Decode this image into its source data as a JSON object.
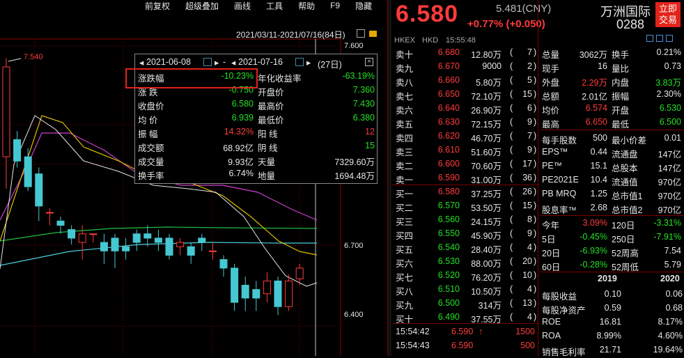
{
  "menu": [
    "前复权",
    "超级叠加",
    "画线",
    "工具",
    "帮助",
    "F9",
    "隐藏"
  ],
  "range_text": "2021/03/11-2021/07/16(84日)",
  "price_axis": {
    "top": "7.600",
    "mid": "6.700",
    "bot": "6.400"
  },
  "high_marker": "7.540",
  "stats_panel": {
    "date_from": "2021-06-08",
    "date_to": "2021-07-16",
    "days": "(27日)",
    "rows": [
      {
        "k1": "涨跌幅",
        "v1": "-10.23%",
        "k2": "年化收益率",
        "v2": "-63.19%"
      },
      {
        "k1": "涨 跌",
        "v1": "-0.750",
        "k2": "开盘价",
        "v2": "7.360"
      },
      {
        "k1": "收盘价",
        "v1": "6.580",
        "k2": "最高价",
        "v2": "7.430"
      },
      {
        "k1": "均 价",
        "v1": "6.939",
        "k2": "最低价",
        "v2": "6.380"
      },
      {
        "k1": "振 幅",
        "v1": "14.32%",
        "k2": "阳 线",
        "v2": "12"
      },
      {
        "k1": "成交额",
        "v1": "68.92亿",
        "k2": "阴 线",
        "v2": "15"
      },
      {
        "k1": "成交量",
        "v1": "9.93亿",
        "k2": "天量",
        "v2": "7329.60万"
      },
      {
        "k1": "换手率",
        "v1": "6.74%",
        "k2": "地量",
        "v2": "1694.48万"
      }
    ]
  },
  "quote": {
    "price": "6.580",
    "change": "+0.77% (+0.050)",
    "cny": "5.481(CNY)",
    "name": "万洲国际",
    "code": "0288",
    "market": "HKEX",
    "ccy": "HKD",
    "time": "15:55:48",
    "trade_btn": "立即交易"
  },
  "asks": [
    {
      "l": "卖十",
      "p": "6.680",
      "v": "12.80万",
      "n": "7"
    },
    {
      "l": "卖九",
      "p": "6.670",
      "v": "9000",
      "n": "2"
    },
    {
      "l": "卖八",
      "p": "6.660",
      "v": "5.80万",
      "n": "5"
    },
    {
      "l": "卖七",
      "p": "6.650",
      "v": "72.10万",
      "n": "15"
    },
    {
      "l": "卖六",
      "p": "6.640",
      "v": "26.90万",
      "n": "6"
    },
    {
      "l": "卖五",
      "p": "6.630",
      "v": "72.15万",
      "n": "9"
    },
    {
      "l": "卖四",
      "p": "6.620",
      "v": "46.70万",
      "n": "7"
    },
    {
      "l": "卖三",
      "p": "6.610",
      "v": "51.60万",
      "n": "9"
    },
    {
      "l": "卖二",
      "p": "6.600",
      "v": "70.60万",
      "n": "17"
    },
    {
      "l": "卖一",
      "p": "6.590",
      "v": "31.00万",
      "n": "36"
    }
  ],
  "bids": [
    {
      "l": "买一",
      "p": "6.580",
      "v": "37.25万",
      "n": "26"
    },
    {
      "l": "买二",
      "p": "6.570",
      "v": "53.50万",
      "n": "15"
    },
    {
      "l": "买三",
      "p": "6.560",
      "v": "24.15万",
      "n": "8"
    },
    {
      "l": "买四",
      "p": "6.550",
      "v": "45.90万",
      "n": "9"
    },
    {
      "l": "买五",
      "p": "6.540",
      "v": "28.40万",
      "n": "4"
    },
    {
      "l": "买六",
      "p": "6.530",
      "v": "88.00万",
      "n": "20"
    },
    {
      "l": "买七",
      "p": "6.520",
      "v": "76.20万",
      "n": "10"
    },
    {
      "l": "买八",
      "p": "6.510",
      "v": "10.50万",
      "n": "4"
    },
    {
      "l": "买九",
      "p": "6.500",
      "v": "314万",
      "n": "13"
    },
    {
      "l": "买十",
      "p": "6.490",
      "v": "37.55万",
      "n": "4"
    }
  ],
  "ticks": [
    {
      "t": "15:54:42",
      "p": "6.590",
      "a": "↑",
      "v": "1500"
    },
    {
      "t": "15:54:43",
      "p": "6.590",
      "a": "",
      "v": "500"
    }
  ],
  "stats1": [
    {
      "k1": "总量",
      "v1": "3062万",
      "k2": "换手",
      "v2": "0.21%"
    },
    {
      "k1": "现手",
      "v1": "16",
      "k2": "量比",
      "v2": "0.73"
    },
    {
      "k1": "外盘",
      "v1": "2.29万",
      "k2": "内盘",
      "v2": "3.83万"
    },
    {
      "k1": "总额",
      "v1": "2.01亿",
      "k2": "振幅",
      "v2": "2.30%"
    },
    {
      "k1": "均价",
      "v1": "6.574",
      "k2": "开盘",
      "v2": "6.530"
    },
    {
      "k1": "最高",
      "v1": "6.650",
      "k2": "最低",
      "v2": "6.500"
    }
  ],
  "stats2": [
    {
      "k1": "每手股数",
      "v1": "500",
      "k2": "最小价差",
      "v2": "0.01"
    },
    {
      "k1": "EPS™",
      "v1": "0.44",
      "k2": "流通盘",
      "v2": "147亿"
    },
    {
      "k1": "PE™",
      "v1": "15.1",
      "k2": "总股本",
      "v2": "147亿"
    },
    {
      "k1": "PE2021E",
      "v1": "10.4",
      "k2": "流通值",
      "v2": "970亿"
    },
    {
      "k1": "PB MRQ",
      "v1": "1.25",
      "k2": "总市值1",
      "v2": "970亿"
    },
    {
      "k1": "股息率™",
      "v1": "2.68",
      "k2": "总市值2",
      "v2": "970亿"
    }
  ],
  "stats3": [
    {
      "k1": "今年",
      "v1": "3.09%",
      "k2": "120日",
      "v2": "-3.31%"
    },
    {
      "k1": "5日",
      "v1": "-0.45%",
      "k2": "250日",
      "v2": "-7.91%"
    },
    {
      "k1": "20日",
      "v1": "-6.93%",
      "k2": "52周高",
      "v2": "7.54"
    },
    {
      "k1": "60日",
      "v1": "-0.28%",
      "k2": "52周低",
      "v2": "5.79"
    }
  ],
  "fin_header": {
    "y1": "2019",
    "y2": "2020"
  },
  "fin": [
    {
      "k": "每股收益",
      "a": "0.10",
      "b": "0.06"
    },
    {
      "k": "每股净资产",
      "a": "0.59",
      "b": "0.68"
    },
    {
      "k": "ROE",
      "a": "16.81",
      "b": "8.17%"
    },
    {
      "k": "ROA",
      "a": "8.99%",
      "b": "4.60%"
    },
    {
      "k": "销售毛利率",
      "a": "21.71",
      "b": "19.64%"
    }
  ],
  "chart_data": {
    "type": "candlestick",
    "ylim": [
      6.3,
      7.65
    ],
    "candles": [
      {
        "o": 7.1,
        "c": 7.52,
        "h": 7.56,
        "l": 6.95
      },
      {
        "o": 7.18,
        "c": 7.08,
        "h": 7.22,
        "l": 7.05
      },
      {
        "o": 7.1,
        "c": 6.96,
        "h": 7.14,
        "l": 6.94
      },
      {
        "o": 7.02,
        "c": 6.87,
        "h": 7.05,
        "l": 6.8
      },
      {
        "o": 6.84,
        "c": 6.84,
        "h": 6.86,
        "l": 6.78
      },
      {
        "o": 6.8,
        "c": 6.78,
        "h": 6.82,
        "l": 6.74
      },
      {
        "o": 6.76,
        "c": 6.72,
        "h": 6.78,
        "l": 6.69
      },
      {
        "o": 6.7,
        "c": 6.74,
        "h": 6.78,
        "l": 6.62
      },
      {
        "o": 6.74,
        "c": 6.74,
        "h": 6.74,
        "l": 6.7
      },
      {
        "o": 6.7,
        "c": 6.66,
        "h": 6.74,
        "l": 6.6
      },
      {
        "o": 6.72,
        "c": 6.66,
        "h": 6.74,
        "l": 6.58
      },
      {
        "o": 6.68,
        "c": 6.66,
        "h": 6.72,
        "l": 6.62
      },
      {
        "o": 6.74,
        "c": 6.7,
        "h": 6.76,
        "l": 6.66
      },
      {
        "o": 6.74,
        "c": 6.72,
        "h": 6.78,
        "l": 6.68
      },
      {
        "o": 6.72,
        "c": 6.7,
        "h": 6.76,
        "l": 6.66
      },
      {
        "o": 6.72,
        "c": 6.64,
        "h": 6.74,
        "l": 6.62
      },
      {
        "o": 6.68,
        "c": 6.7,
        "h": 6.72,
        "l": 6.64
      },
      {
        "o": 6.68,
        "c": 6.64,
        "h": 6.7,
        "l": 6.6
      },
      {
        "o": 6.72,
        "c": 6.7,
        "h": 6.74,
        "l": 6.66
      },
      {
        "o": 6.66,
        "c": 6.66,
        "h": 6.7,
        "l": 6.62
      },
      {
        "o": 6.62,
        "c": 6.58,
        "h": 6.64,
        "l": 6.54
      },
      {
        "o": 6.58,
        "c": 6.42,
        "h": 6.6,
        "l": 6.38
      },
      {
        "o": 6.5,
        "c": 6.44,
        "h": 6.54,
        "l": 6.38
      },
      {
        "o": 6.48,
        "c": 6.44,
        "h": 6.52,
        "l": 6.38
      },
      {
        "o": 6.46,
        "c": 6.52,
        "h": 6.56,
        "l": 6.42
      },
      {
        "o": 6.52,
        "c": 6.4,
        "h": 6.54,
        "l": 6.36
      },
      {
        "o": 6.4,
        "c": 6.52,
        "h": 6.55,
        "l": 6.38
      },
      {
        "o": 6.53,
        "c": 6.58,
        "h": 6.6,
        "l": 6.5
      }
    ],
    "up_color": "#ff3b3b",
    "down_color": "#45c8d2"
  },
  "colors": {
    "up": "#ff3b3b",
    "down": "#25e025",
    "panel_bg": "#000000",
    "grid": "#8b0000"
  }
}
